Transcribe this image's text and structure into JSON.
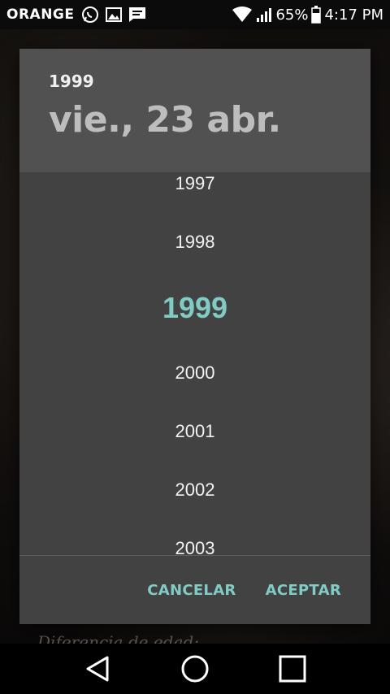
{
  "status_bar": {
    "carrier": "ORANGE",
    "battery": "65%",
    "time": "4:17 PM",
    "icons": [
      "whatsapp-icon",
      "image-icon",
      "message-icon",
      "wifi-icon",
      "signal-icon",
      "battery-icon"
    ]
  },
  "background": {
    "partial_text": "Diferencia de edad:"
  },
  "dialog": {
    "header": {
      "year": "1999",
      "date": "vie., 23 abr."
    },
    "years": [
      "1997",
      "1998",
      "1999",
      "2000",
      "2001",
      "2002",
      "2003"
    ],
    "selected_year": "1999",
    "accent_color": "#80cbc4",
    "actions": {
      "cancel": "CANCELAR",
      "accept": "ACEPTAR"
    }
  },
  "nav_bar": {
    "icons": [
      "back-icon",
      "home-icon",
      "recents-icon"
    ]
  }
}
